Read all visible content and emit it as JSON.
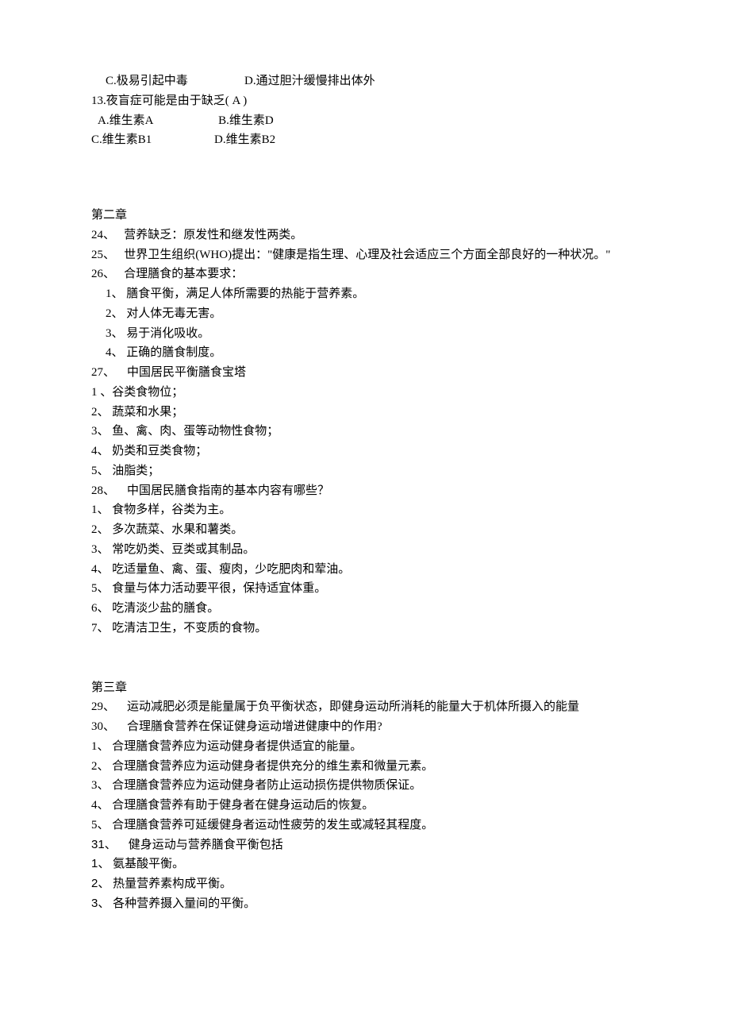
{
  "q12": {
    "optC": "C.极易引起中毒",
    "optD": "D.通过胆汁缓慢排出体外"
  },
  "q13": {
    "stem": "13.夜盲症可能是由于缺乏( A )",
    "optA": "A.维生素A",
    "optB": "B.维生素D",
    "optC": "C.维生素B1",
    "optD": "D.维生素B2"
  },
  "chapter2": {
    "title": "第二章",
    "p24": "24、   营养缺乏：原发性和继发性两类。",
    "p25": "25、   世界卫生组织(WHO)提出：\"健康是指生理、心理及社会适应三个方面全部良好的一种状况。\"",
    "p26": "26、   合理膳食的基本要求：",
    "p26_1": "1、 膳食平衡，满足人体所需要的热能于营养素。",
    "p26_2": "2、 对人体无毒无害。",
    "p26_3": "3、 易于消化吸收。",
    "p26_4": "4、 正确的膳食制度。",
    "p27": "27、    中国居民平衡膳食宝塔",
    "p27_1": "1 、谷类食物位；",
    "p27_2": "2、 蔬菜和水果；",
    "p27_3": "3、 鱼、禽、肉、蛋等动物性食物；",
    "p27_4": "4、 奶类和豆类食物；",
    "p27_5": "5、 油脂类；",
    "p28": "28、    中国居民膳食指南的基本内容有哪些？",
    "p28_1": "1、 食物多样，谷类为主。",
    "p28_2": "2、 多次蔬菜、水果和薯类。",
    "p28_3": "3、 常吃奶类、豆类或其制品。",
    "p28_4": "4、 吃适量鱼、禽、蛋、瘦肉，少吃肥肉和荤油。",
    "p28_5": "5、 食量与体力活动要平很，保持适宜体重。",
    "p28_6": "6、 吃清淡少盐的膳食。",
    "p28_7": "7、 吃清洁卫生，不变质的食物。"
  },
  "chapter3": {
    "title": "第三章",
    "p29": "29、    运动减肥必须是能量属于负平衡状态，即健身运动所消耗的能量大于机体所摄入的能量",
    "p30": "30、    合理膳食营养在保证健身运动增进健康中的作用?",
    "p30_1": "1、 合理膳食营养应为运动健身者提供适宜的能量。",
    "p30_2": "2、 合理膳食营养应为运动健身者提供充分的维生素和微量元素。",
    "p30_3": "3、 合理膳食营养应为运动健身者防止运动损伤提供物质保证。",
    "p30_4": "4、 合理膳食营养有助于健身者在健身运动后的恢复。",
    "p30_5": "5、 合理膳食营养可延缓健身者运动性疲劳的发生或减轻其程度。",
    "p31_num": "31",
    "p31_text": "、    健身运动与营养膳食平衡包括",
    "p31_1n": "1",
    "p31_1t": "、 氨基酸平衡。",
    "p31_2n": "2",
    "p31_2t": "、 热量营养素构成平衡。",
    "p31_3n": "3",
    "p31_3t": "、 各种营养摄入量间的平衡。"
  }
}
